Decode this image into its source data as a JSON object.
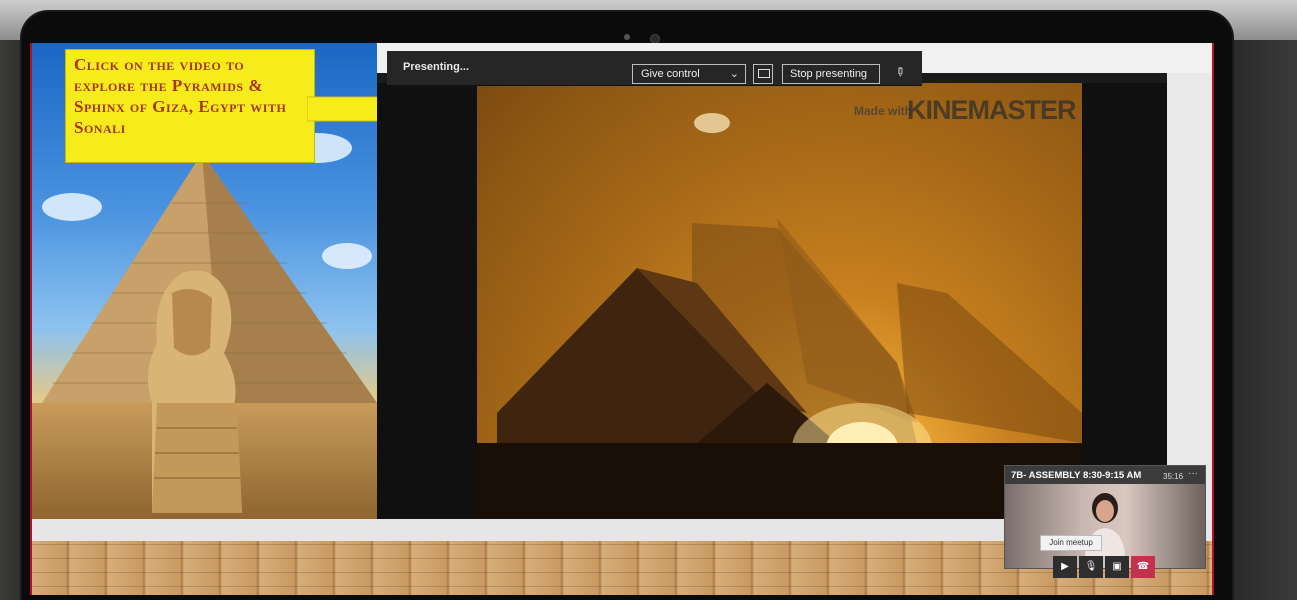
{
  "presenting": {
    "status_label": "Presenting...",
    "give_control_label": "Give control",
    "stop_presenting_label": "Stop presenting"
  },
  "slide": {
    "banner_text": "Click on the video to explore the Pyramids & Sphinx of Giza, Egypt with Sonali"
  },
  "video": {
    "watermark_prefix": "Made with",
    "watermark_brand": "KINEMASTER"
  },
  "mini_window": {
    "title": "7B- ASSEMBLY 8:30-9:15 AM",
    "elapsed": "35:16",
    "more_icon": "ellipsis-icon",
    "controls": [
      "camera-icon",
      "microphone-icon",
      "share-screen-icon",
      "hang-up-icon"
    ]
  },
  "tooltip": {
    "label": "Join meetup"
  },
  "colors": {
    "banner_bg": "#f7ec1b",
    "banner_text": "#a8341f",
    "hang_up": "#c4314b"
  }
}
